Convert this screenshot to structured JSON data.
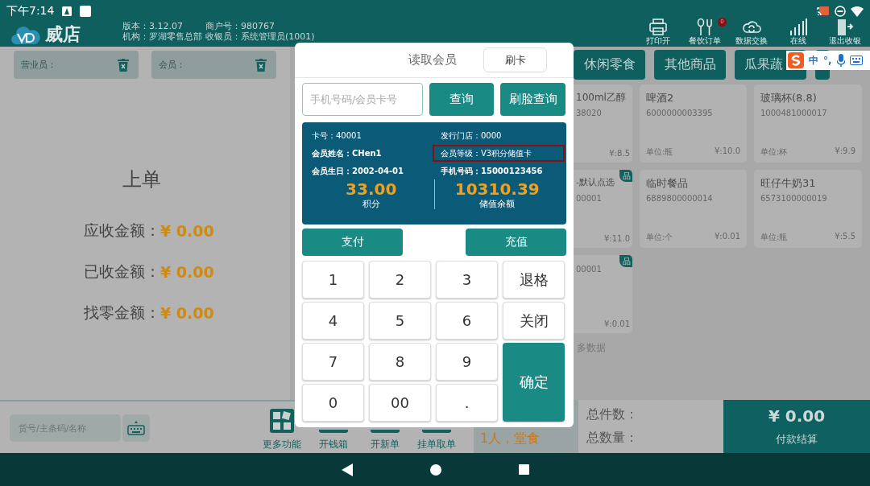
{
  "status_bar": {
    "time": "下午7:14"
  },
  "header": {
    "app_name": "威店",
    "info": [
      "版本：3.12.07",
      "商户号：980767",
      "机构：罗湖零售总部",
      "收银员：系统管理员(1001)"
    ],
    "toolbar": [
      {
        "kind": "printer",
        "label": "打印开"
      },
      {
        "kind": "cutlery",
        "label": "餐饮订单",
        "badge": "0"
      },
      {
        "kind": "cloud",
        "label": "数据交换"
      },
      {
        "kind": "signal",
        "label": "在线"
      },
      {
        "kind": "exit",
        "label": "退出收银"
      }
    ]
  },
  "fields": [
    {
      "label": "营业员："
    },
    {
      "label": "会员："
    }
  ],
  "order": {
    "title": "上单",
    "amounts": [
      {
        "label": "应收金额：",
        "value": "¥ 0.00"
      },
      {
        "label": "已收金额：",
        "value": "¥ 0.00"
      },
      {
        "label": "找零金额：",
        "value": "¥ 0.00"
      }
    ]
  },
  "categories": [
    {
      "label": "休闲零食"
    },
    {
      "label": "其他商品"
    },
    {
      "label": "瓜果蔬"
    }
  ],
  "ime_bar": {
    "items": [
      "中",
      "°,"
    ]
  },
  "products": [
    {
      "name": "100ml乙醇",
      "code": "38020",
      "price": "¥:8.5"
    },
    {
      "name": "啤酒2",
      "code": "6000000003395",
      "unit": "单位:瓶",
      "price": "¥:10.0"
    },
    {
      "name": "玻璃杯(8.8)",
      "code": "1000481000017",
      "unit": "单位:杯",
      "price": "¥:9.9"
    },
    {
      "name": "-默认点选",
      "code": "00001",
      "price": "¥:11.0",
      "tag": "品"
    },
    {
      "name": "临时餐品",
      "code": "6889800000014",
      "unit": "单位:个",
      "price": "¥:0.01"
    },
    {
      "name": "旺仔牛奶31",
      "code": "6573100000019",
      "unit": "单位:瓶",
      "price": "¥:5.5"
    },
    {
      "code": "00001",
      "price": "¥:0.01",
      "tag": "品"
    }
  ],
  "more_text": "多数据",
  "search": {
    "placeholder": "货号/主条码/名称"
  },
  "actions": [
    {
      "kind": "grid",
      "label": "更多功能"
    },
    {
      "kind": "hidden",
      "label": "开钱箱"
    },
    {
      "kind": "hidden",
      "label": "开新单"
    },
    {
      "kind": "hidden",
      "label": "挂单取单"
    }
  ],
  "dine_info": "1人，堂食",
  "totals": [
    {
      "label": "总件数："
    },
    {
      "label": "总数量："
    }
  ],
  "pay": {
    "amount": "¥ 0.00",
    "label": "付款结算"
  },
  "modal": {
    "title": "读取会员",
    "card_button": "刷卡",
    "placeholder": "手机号码/会员卡号",
    "query_buttons": [
      "查询",
      "刷脸查询"
    ],
    "info": [
      {
        "text": "卡号：40001",
        "highlighted": false
      },
      {
        "text": "发行门店：0000",
        "highlighted": false
      },
      {
        "text": "会员姓名：CHen1",
        "highlighted": false
      },
      {
        "text": "会员等级：V3积分储值卡",
        "highlighted": true
      },
      {
        "text": "会员生日：2002-04-01",
        "highlighted": false
      },
      {
        "text": "手机号码：15000123456",
        "highlighted": false
      }
    ],
    "stats": [
      {
        "value": "33.00",
        "label": "积分"
      },
      {
        "value": "10310.39",
        "label": "储值余额"
      }
    ],
    "actions": [
      "支付",
      "充值"
    ],
    "keys": [
      {
        "label": "1"
      },
      {
        "label": "2"
      },
      {
        "label": "3"
      },
      {
        "label": "退格"
      },
      {
        "label": "4"
      },
      {
        "label": "5"
      },
      {
        "label": "6"
      },
      {
        "label": "关闭"
      },
      {
        "label": "7"
      },
      {
        "label": "8"
      },
      {
        "label": "9"
      },
      {
        "label": "确定",
        "kind": "confirm"
      },
      {
        "label": "0"
      },
      {
        "label": "00"
      },
      {
        "label": "."
      }
    ]
  }
}
